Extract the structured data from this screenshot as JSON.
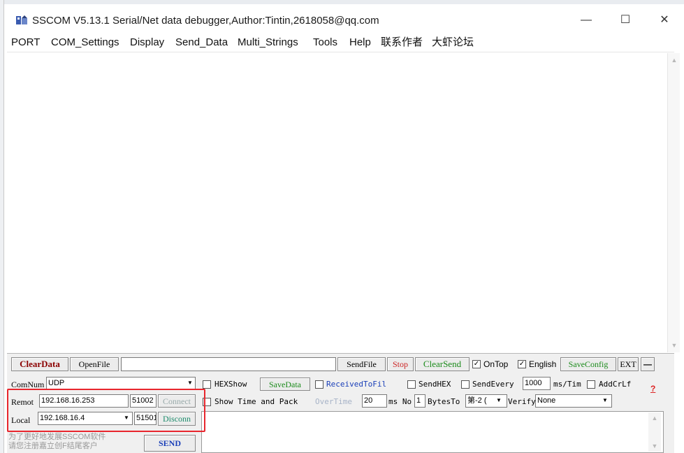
{
  "window": {
    "title": "SSCOM V5.13.1 Serial/Net data debugger,Author:Tintin,2618058@qq.com",
    "minimize": "—",
    "maximize": "☐",
    "close": "✕"
  },
  "menu": {
    "items": [
      "PORT",
      "COM_Settings",
      "Display",
      "Send_Data",
      "Multi_Strings",
      "Tools",
      "Help",
      "联系作者",
      "大虾论坛"
    ]
  },
  "receive": {
    "content": "",
    "scroll_up": "▲",
    "scroll_down": "▼"
  },
  "toolbar": {
    "clear_data": "ClearData",
    "open_file": "OpenFile",
    "file_path": "",
    "send_file": "SendFile",
    "stop": "Stop",
    "clear_send": "ClearSend",
    "on_top": "OnTop",
    "on_top_checked": true,
    "english": "English",
    "english_checked": true,
    "save_config": "SaveConfig",
    "ext": "EXT",
    "minus": "—"
  },
  "connection": {
    "comnum_label": "ComNum",
    "comnum_value": "UDP",
    "remote_label": "Remot",
    "remote_ip": "192.168.16.253",
    "remote_port": "51002",
    "connect": "Connect",
    "local_label": "Local",
    "local_ip": "192.168.16.4",
    "local_port": "51501",
    "disconnect": "Disconn"
  },
  "options": {
    "hex_show": "HEXShow",
    "save_data": "SaveData",
    "received_to_file": "ReceivedToFil",
    "send_hex": "SendHEX",
    "send_every": "SendEvery",
    "send_every_value": "1000",
    "ms_tim": "ms/Tim",
    "add_crlf": "AddCrLf",
    "help_q": "?",
    "show_time": "Show Time and Pack",
    "overtime": "OverTime",
    "overtime_value": "20",
    "ms_no": "ms No",
    "no_value": "1",
    "bytes_to": "BytesTo",
    "bytes_value": "第-2 (",
    "verify": "Verify",
    "verify_value": "None"
  },
  "send": {
    "text": "",
    "send_button": "SEND",
    "promo_line1": "为了更好地发展SSCOM软件",
    "promo_line2": "请您注册嘉立创F结尾客户"
  },
  "colors": {
    "clear_data": "#8b0000",
    "green_text": "#1a8a1a",
    "blue_text": "#1a3fb8",
    "red_box": "#e8262d"
  }
}
